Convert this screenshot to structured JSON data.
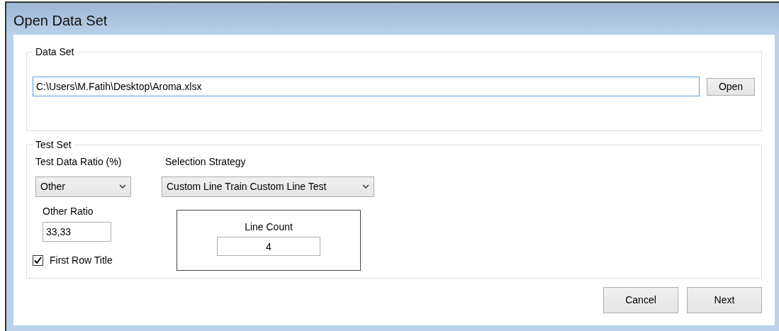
{
  "window": {
    "title": "Open Data Set"
  },
  "data_set": {
    "legend": "Data Set",
    "path": {
      "value": "C:\\Users\\M.Fatih\\Desktop\\Aroma.xlsx",
      "focused": true
    },
    "open_button": "Open"
  },
  "test_set": {
    "legend": "Test Set",
    "ratio_label": "Test Data Ratio (%)",
    "ratio_select": "Other",
    "strategy_label": "Selection Strategy",
    "strategy_select": "Custom Line Train Custom Line Test",
    "other_ratio": {
      "label": "Other Ratio",
      "value": "33,33"
    },
    "first_row_title": {
      "label": "First Row Title",
      "checked": true
    },
    "line_count": {
      "label": "Line Count",
      "value": "4"
    }
  },
  "buttons": [
    "Cancel",
    "Next"
  ]
}
